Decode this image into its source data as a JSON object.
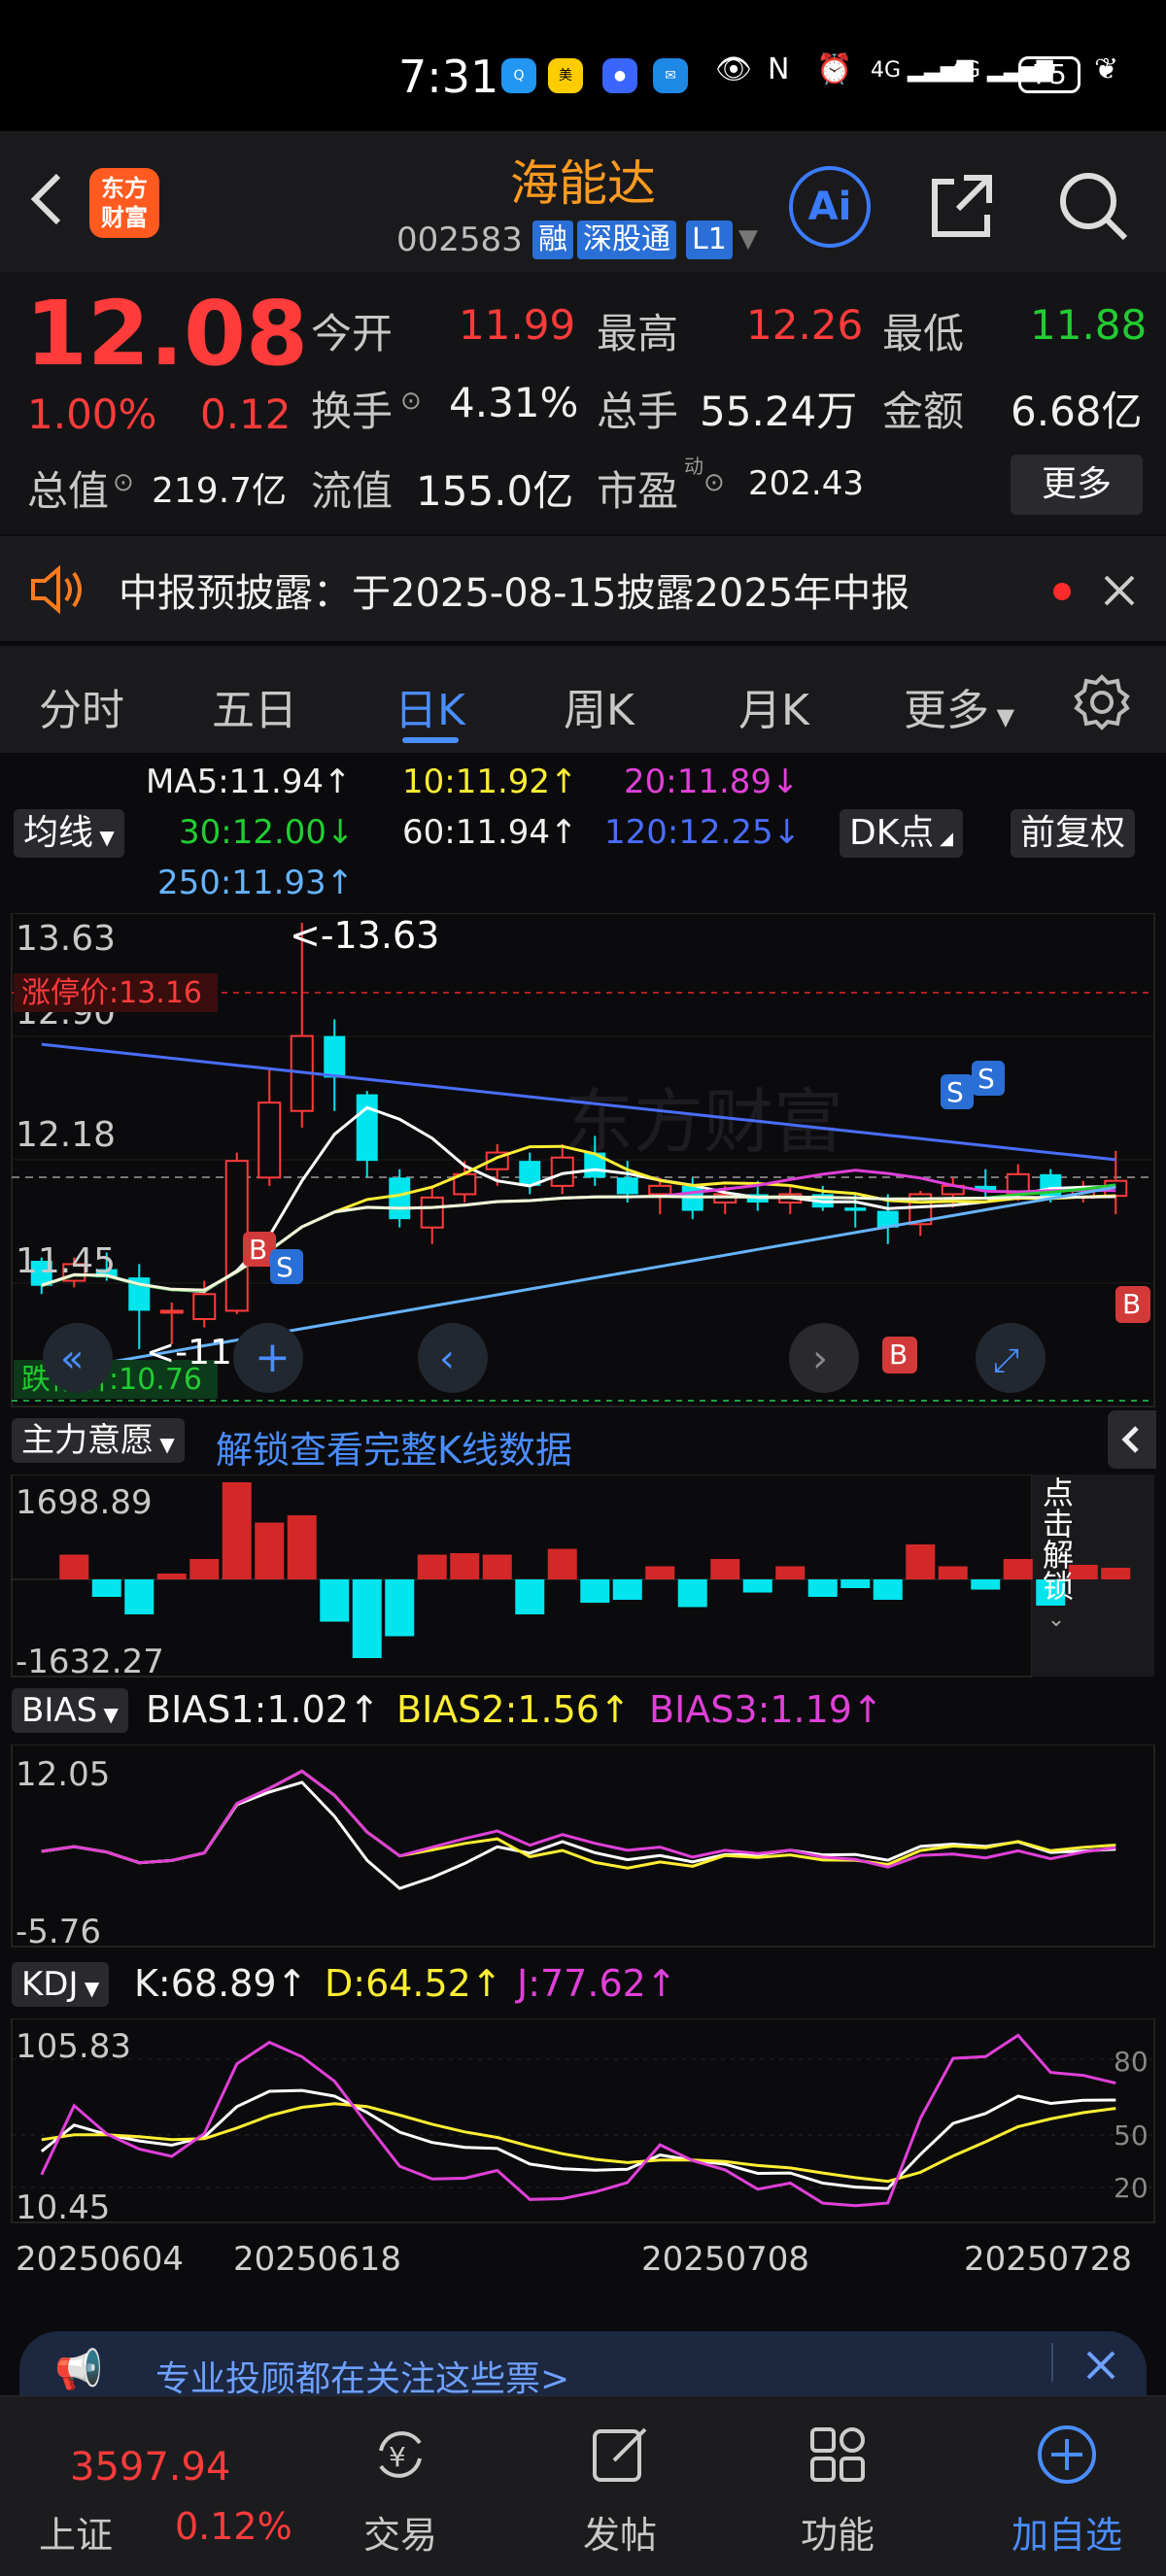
{
  "status_bar": {
    "time": "7:31",
    "net1": "4G",
    "net2": "4G",
    "battery": "75"
  },
  "header": {
    "stock_name": "海能达",
    "stock_code": "002583",
    "tags": [
      "融",
      "深股通",
      "L1"
    ],
    "logo_text_line1": "东方",
    "logo_text_line2": "财富",
    "ai_label": "Ai"
  },
  "quote": {
    "price": "12.08",
    "change_pct": "1.00%",
    "change": "0.12",
    "open_label": "今开",
    "open": "11.99",
    "high_label": "最高",
    "high": "12.26",
    "low_label": "最低",
    "low": "11.88",
    "turnover_label": "换手",
    "turnover": "4.31%",
    "volume_label": "总手",
    "volume": "55.24万",
    "amount_label": "金额",
    "amount": "6.68亿",
    "mktcap_label": "总值",
    "mktcap": "219.7亿",
    "float_label": "流值",
    "float": "155.0亿",
    "pe_label": "市盈",
    "pe_sup": "动",
    "pe": "202.43",
    "more_label": "更多"
  },
  "notice": {
    "text": "中报预披露：于2025-08-15披露2025年中报"
  },
  "tabs": [
    "分时",
    "五日",
    "日K",
    "周K",
    "月K",
    "更多"
  ],
  "active_tab": 2,
  "ma_legend": {
    "selector": "均线",
    "ma5": "MA5:11.94↑",
    "ma10": "10:11.92↑",
    "ma20": "20:11.89↓",
    "ma30": "30:12.00↓",
    "ma60": "60:11.94↑",
    "ma120": "120:12.25↓",
    "ma250": "250:11.93↑",
    "dk_label": "DK点",
    "adjust_label": "前复权"
  },
  "kline": {
    "y_top": "13.63",
    "y_2": "12.90",
    "y_3": "12.18",
    "y_4": "11.45",
    "limit_up": "涨停价:13.16",
    "limit_down": "跌停价:10.76",
    "high_marker": "<-13.63",
    "low_marker": "<-11.07",
    "watermark": "东方财富"
  },
  "chart_data": {
    "type": "candlestick",
    "x_first": "20250604",
    "x_ticks": [
      "20250604",
      "20250618",
      "20250708",
      "20250728"
    ],
    "ylim": [
      10.76,
      13.63
    ],
    "candles": [
      [
        11.6,
        11.62,
        11.4,
        11.45
      ],
      [
        11.48,
        11.62,
        11.44,
        11.58
      ],
      [
        11.55,
        11.65,
        11.48,
        11.5
      ],
      [
        11.5,
        11.58,
        11.07,
        11.3
      ],
      [
        11.3,
        11.35,
        11.1,
        11.3
      ],
      [
        11.25,
        11.48,
        11.2,
        11.4
      ],
      [
        11.3,
        12.25,
        11.28,
        12.2
      ],
      [
        12.1,
        12.75,
        12.05,
        12.55
      ],
      [
        12.5,
        13.63,
        12.4,
        12.95
      ],
      [
        12.95,
        13.05,
        12.5,
        12.7
      ],
      [
        12.6,
        12.62,
        12.1,
        12.2
      ],
      [
        12.1,
        12.15,
        11.8,
        11.85
      ],
      [
        11.8,
        12.05,
        11.7,
        11.98
      ],
      [
        12.0,
        12.2,
        11.95,
        12.12
      ],
      [
        12.15,
        12.3,
        12.05,
        12.25
      ],
      [
        12.2,
        12.25,
        12.0,
        12.05
      ],
      [
        12.05,
        12.3,
        12.0,
        12.22
      ],
      [
        12.25,
        12.35,
        12.05,
        12.1
      ],
      [
        12.1,
        12.2,
        11.95,
        12.0
      ],
      [
        12.0,
        12.1,
        11.88,
        12.05
      ],
      [
        12.05,
        12.1,
        11.85,
        11.9
      ],
      [
        11.95,
        12.05,
        11.88,
        12.0
      ],
      [
        12.0,
        12.08,
        11.9,
        11.95
      ],
      [
        11.95,
        12.05,
        11.88,
        12.0
      ],
      [
        12.0,
        12.05,
        11.9,
        11.92
      ],
      [
        11.92,
        12.0,
        11.8,
        11.9
      ],
      [
        11.9,
        12.0,
        11.7,
        11.8
      ],
      [
        11.82,
        12.02,
        11.75,
        12.0
      ],
      [
        12.0,
        12.1,
        11.92,
        12.05
      ],
      [
        12.05,
        12.15,
        11.98,
        12.02
      ],
      [
        12.0,
        12.18,
        11.96,
        12.12
      ],
      [
        12.12,
        12.15,
        11.95,
        11.98
      ],
      [
        11.98,
        12.08,
        11.95,
        12.04
      ],
      [
        11.99,
        12.26,
        11.88,
        12.08
      ]
    ],
    "indicators": {
      "main_force": {
        "label": "主力意愿",
        "top": "1698.89",
        "bottom": "-1632.27",
        "unlock_text": "解锁查看完整K线数据",
        "side_text": "点击解锁"
      },
      "bias": {
        "label": "BIAS",
        "b1": "BIAS1:1.02↑",
        "b2": "BIAS2:1.56↑",
        "b3": "BIAS3:1.19↑",
        "top": "12.05",
        "bottom": "-5.76"
      },
      "kdj": {
        "label": "KDJ",
        "k": "K:68.89↑",
        "d": "D:64.52↑",
        "j": "J:77.62↑",
        "top": "105.83",
        "bottom": "10.45",
        "r80": "80",
        "r50": "50",
        "r20": "20"
      }
    }
  },
  "banner": {
    "text": "专业投顾都在关注这些票>"
  },
  "bottom_nav": {
    "index_value": "3597.94",
    "index_name": "上证",
    "index_pct": "0.12%",
    "items": [
      "交易",
      "发帖",
      "功能",
      "加自选"
    ]
  },
  "colors": {
    "up": "#ff3b3b",
    "down": "#00e5ee",
    "accent": "#4a8dff",
    "brand": "#ff5a1f"
  }
}
